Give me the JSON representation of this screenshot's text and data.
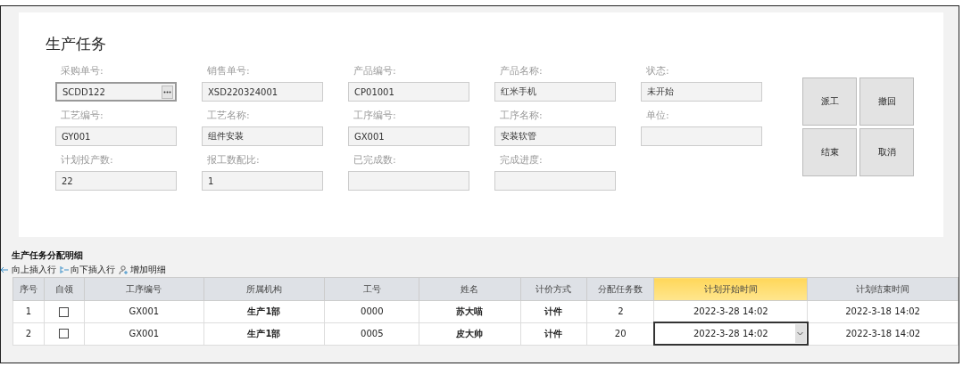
{
  "title": "生产任务",
  "fields": [
    {
      "label": "采购单号:",
      "value": "SCDD122",
      "kind": "lookup"
    },
    {
      "label": "销售单号:",
      "value": "XSD220324001",
      "kind": "text"
    },
    {
      "label": "产品编号:",
      "value": "CP01001",
      "kind": "text"
    },
    {
      "label": "产品名称:",
      "value": "红米手机",
      "kind": "text"
    },
    {
      "label": "状态:",
      "value": "未开始",
      "kind": "text"
    },
    {
      "label": "工艺编号:",
      "value": "GY001",
      "kind": "text"
    },
    {
      "label": "工艺名称:",
      "value": "组件安装",
      "kind": "text"
    },
    {
      "label": "工序编号:",
      "value": "GX001",
      "kind": "text"
    },
    {
      "label": "工序名称:",
      "value": "安装软管",
      "kind": "text"
    },
    {
      "label": "单位:",
      "kind": "text"
    },
    {
      "label": "计划投产数:",
      "value": "22",
      "kind": "text"
    },
    {
      "label": "报工数配比:",
      "value": "1",
      "kind": "text"
    },
    {
      "label": "已完成数:",
      "kind": "text"
    },
    {
      "label": "完成进度:",
      "kind": "text"
    }
  ],
  "buttons": [
    "派工",
    "撤回",
    "结束",
    "取消"
  ],
  "detail": {
    "title": "生产任务分配明细",
    "toolbar": [
      {
        "label": "向上插入行",
        "kind": "insert-above"
      },
      {
        "label": "向下插入行",
        "kind": "insert-below"
      },
      {
        "label": "增加明细",
        "kind": "add"
      }
    ],
    "columns": [
      {
        "label": "序号",
        "selected": false
      },
      {
        "label": "自领",
        "selected": false
      },
      {
        "label": "工序编号",
        "selected": false
      },
      {
        "label": "所属机构",
        "selected": false
      },
      {
        "label": "工号",
        "selected": false
      },
      {
        "label": "姓名",
        "selected": false
      },
      {
        "label": "计价方式",
        "selected": false
      },
      {
        "label": "分配任务数",
        "selected": false
      },
      {
        "label": "计划开始时间",
        "selected": true
      },
      {
        "label": "计划结束时间",
        "selected": false
      }
    ],
    "rows": [
      {
        "no": "1",
        "self_claim": false,
        "process": "GX001",
        "org": "生产1部",
        "emp_no": "0000",
        "name": "苏大喵",
        "pricing": "计件",
        "qty": "2",
        "start": "2022-3-28 14:02",
        "end": "2022-3-18 14:02",
        "editing": false
      },
      {
        "no": "2",
        "self_claim": false,
        "process": "GX001",
        "org": "生产1部",
        "emp_no": "0005",
        "name": "皮大帅",
        "pricing": "计件",
        "qty": "20",
        "start": "2022-3-28 14:02",
        "end": "2022-3-18 14:02",
        "editing": true
      }
    ]
  }
}
